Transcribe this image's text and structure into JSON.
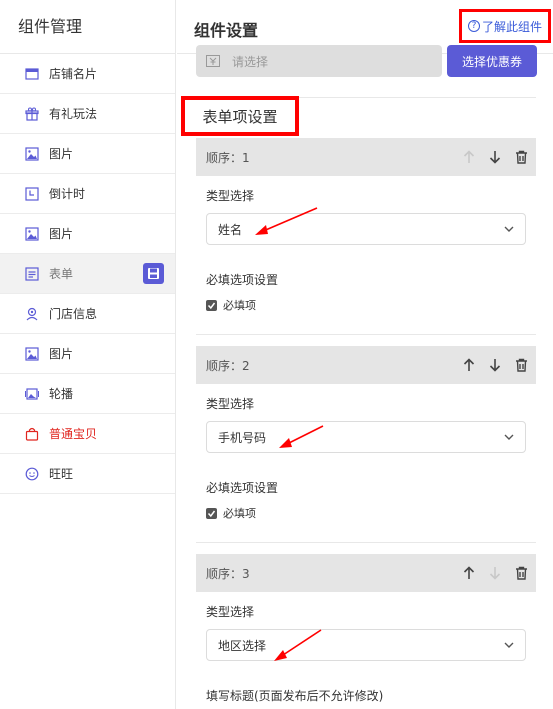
{
  "sidebar": {
    "title": "组件管理",
    "items": [
      {
        "label": "店铺名片",
        "icon": "storefront-icon"
      },
      {
        "label": "有礼玩法",
        "icon": "gift-icon"
      },
      {
        "label": "图片",
        "icon": "image-icon"
      },
      {
        "label": "倒计时",
        "icon": "clock-icon"
      },
      {
        "label": "图片",
        "icon": "image-icon"
      },
      {
        "label": "表单",
        "icon": "form-icon",
        "active": true
      },
      {
        "label": "门店信息",
        "icon": "location-icon"
      },
      {
        "label": "图片",
        "icon": "image-icon"
      },
      {
        "label": "轮播",
        "icon": "carousel-icon"
      },
      {
        "label": "普通宝贝",
        "icon": "shopping-bag-icon",
        "color": "#e0251f"
      },
      {
        "label": "旺旺",
        "icon": "chat-icon"
      }
    ]
  },
  "header": {
    "title": "组件设置",
    "learn_link": "了解此组件"
  },
  "coupon": {
    "placeholder": "请选择",
    "button": "选择优惠券"
  },
  "form_settings": {
    "title": "表单项设置",
    "items": [
      {
        "order": "顺序：1",
        "type_label": "类型选择",
        "type_value": "姓名",
        "required_label": "必填选项设置",
        "required_checkbox": "必填项"
      },
      {
        "order": "顺序：2",
        "type_label": "类型选择",
        "type_value": "手机号码",
        "required_label": "必填选项设置",
        "required_checkbox": "必填项"
      },
      {
        "order": "顺序：3",
        "type_label": "类型选择",
        "type_value": "地区选择",
        "title_label": "填写标题(页面发布后不允许修改)"
      }
    ]
  },
  "colors": {
    "accent": "#5b5bd6",
    "highlight": "#ff0000",
    "link": "#3a5bd9"
  }
}
